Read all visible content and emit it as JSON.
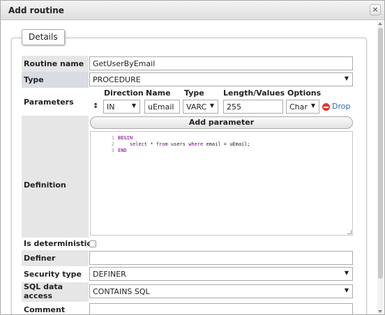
{
  "dialog": {
    "title": "Add routine",
    "close_glyph": "×"
  },
  "fieldset": {
    "legend": "Details"
  },
  "fields": {
    "routine_name_label": "Routine name",
    "routine_name_value": "GetUserByEmail",
    "type_label": "Type",
    "type_value": "PROCEDURE",
    "parameters_label": "Parameters",
    "definition_label": "Definition",
    "deterministic_label": "Is deterministic",
    "definer_label": "Definer",
    "definer_value": "",
    "security_type_label": "Security type",
    "security_type_value": "DEFINER",
    "sql_access_label_1": "SQL data",
    "sql_access_label_2": "access",
    "sql_access_value": "CONTAINS SQL",
    "comment_label": "Comment"
  },
  "parameters": {
    "headers": {
      "direction": "Direction",
      "name": "Name",
      "type": "Type",
      "length": "Length/Values",
      "options": "Options"
    },
    "row": {
      "move_glyph": "↕",
      "direction": "IN",
      "name": "uEmail",
      "type": "VARC",
      "length": "255",
      "options": "Char",
      "drop_label": "Drop"
    },
    "add_button": "Add parameter"
  },
  "editor": {
    "line_numbers": [
      "1",
      "2",
      "3"
    ],
    "lines": {
      "l1": "BEGIN",
      "l2_pre": "    ",
      "l2_select": "select",
      "l2_mid1": " * ",
      "l2_from": "from",
      "l2_mid2": " users ",
      "l2_where": "where",
      "l2_post": " email = uEmail;",
      "l3": "END"
    }
  },
  "icons": {
    "select_arrow": "▼",
    "drop": "minus-circle-icon",
    "move": "updown-arrow-icon"
  },
  "colors": {
    "label_bg": "#e6e6e6",
    "keyword": "#770088",
    "drop_red": "#e03a2f",
    "drop_link": "#2a6fb0"
  }
}
